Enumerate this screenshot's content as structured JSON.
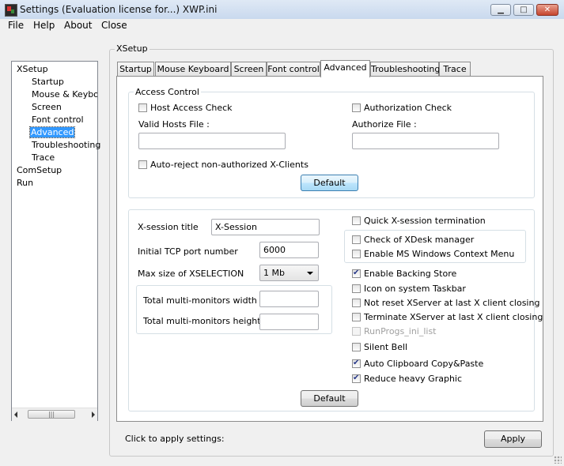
{
  "window": {
    "title": "Settings (Evaluation license for...) XWP.ini"
  },
  "menu": {
    "file": "File",
    "help": "Help",
    "about": "About",
    "close": "Close"
  },
  "group_label": "XSetup",
  "tree": {
    "root_xsetup": "XSetup",
    "startup": "Startup",
    "mouse_keyboard": "Mouse & Keyboar",
    "screen": "Screen",
    "font_control": "Font control",
    "advanced": "Advanced",
    "troubleshooting": "Troubleshooting",
    "trace": "Trace",
    "comsetup": "ComSetup",
    "run": "Run",
    "selected": "Advanced",
    "scroll_thumb_glyph": "|||"
  },
  "tabs": {
    "startup": "Startup",
    "mouse_keyboard": "Mouse  Keyboard",
    "screen": "Screen",
    "font_control": "Font control",
    "advanced": "Advanced",
    "troubleshooting": "Troubleshooting",
    "trace": "Trace",
    "active": "Advanced"
  },
  "access_control": {
    "legend": "Access Control",
    "host_access_check": {
      "label": "Host Access Check",
      "checked": false
    },
    "authorization_check": {
      "label": "Authorization Check",
      "checked": false
    },
    "valid_hosts_label": "Valid Hosts File :",
    "valid_hosts_value": "",
    "authorize_file_label": "Authorize File :",
    "authorize_file_value": "",
    "auto_reject": {
      "label": "Auto-reject non-authorized X-Clients",
      "checked": false
    },
    "default_button": "Default"
  },
  "session": {
    "title_label": "X-session title",
    "title_value": "X-Session",
    "tcp_label": "Initial TCP port number",
    "tcp_value": "6000",
    "xselection_label": "Max size of XSELECTION",
    "xselection_value": "1 Mb",
    "monitors_width_label": "Total multi-monitors width",
    "monitors_width_value": "",
    "monitors_height_label": "Total multi-monitors height",
    "monitors_height_value": ""
  },
  "options": {
    "quick_termination": {
      "label": "Quick X-session termination",
      "checked": false
    },
    "check_xdesk": {
      "label": "Check of XDesk manager",
      "checked": false
    },
    "ms_context_menu": {
      "label": "Enable MS Windows Context Menu",
      "checked": false
    },
    "backing_store": {
      "label": "Enable Backing Store",
      "checked": true
    },
    "icon_taskbar": {
      "label": "Icon on system Taskbar",
      "checked": false
    },
    "not_reset": {
      "label": "Not reset XServer at last X client closing",
      "checked": false
    },
    "terminate": {
      "label": "Terminate XServer at last X client closing",
      "checked": false
    },
    "runprogs": {
      "label": "RunProgs_ini_list",
      "checked": false,
      "disabled": true
    },
    "silent_bell": {
      "label": "Silent Bell",
      "checked": false
    },
    "auto_clipboard": {
      "label": "Auto Clipboard Copy&Paste",
      "checked": true
    },
    "reduce_graphic": {
      "label": "Reduce heavy Graphic",
      "checked": true
    }
  },
  "default_button_2": "Default",
  "status": {
    "text": "Click to apply settings:"
  },
  "apply_button": "Apply",
  "colors": {
    "selection": "#3399ff",
    "window_bg": "#f0f0f0",
    "titlebar": "#c9d9ee"
  }
}
